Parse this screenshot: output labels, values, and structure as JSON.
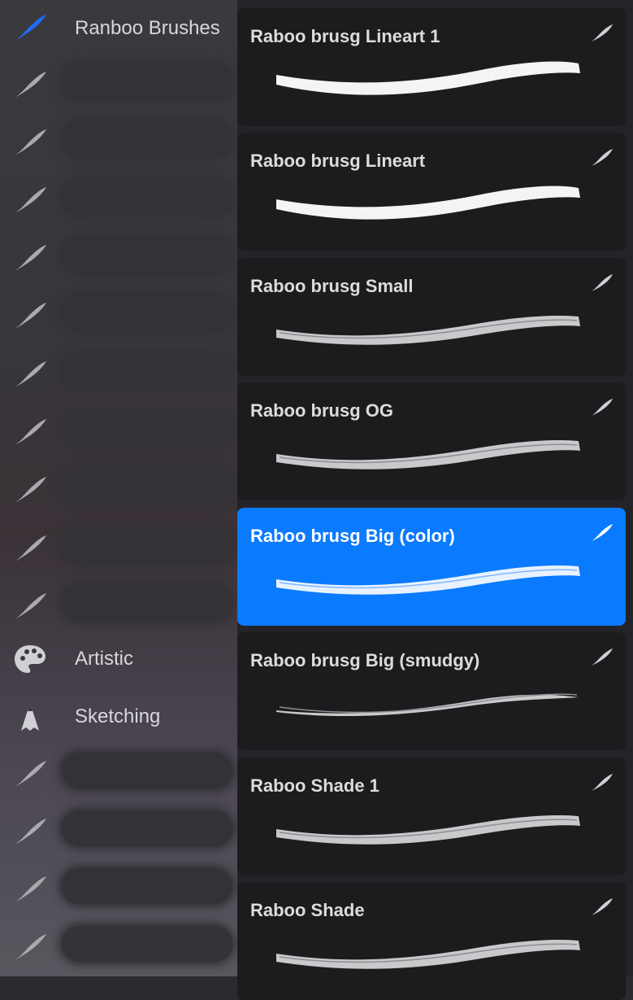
{
  "sidebar": {
    "accent_color": "#1e6ef5",
    "items": [
      {
        "label": "Ranboo Brushes",
        "icon": "brush-stroke-icon",
        "selected": true,
        "redacted": false
      },
      {
        "label": "",
        "icon": "brush-stroke-icon",
        "redacted": true
      },
      {
        "label": "",
        "icon": "brush-stroke-icon",
        "redacted": true
      },
      {
        "label": "",
        "icon": "brush-stroke-icon",
        "redacted": true
      },
      {
        "label": "",
        "icon": "brush-stroke-icon",
        "redacted": true
      },
      {
        "label": "",
        "icon": "brush-stroke-icon",
        "redacted": true
      },
      {
        "label": "",
        "icon": "brush-stroke-icon",
        "redacted": true
      },
      {
        "label": "",
        "icon": "brush-stroke-icon",
        "redacted": true
      },
      {
        "label": "",
        "icon": "brush-stroke-icon",
        "redacted": true
      },
      {
        "label": "",
        "icon": "brush-stroke-icon",
        "redacted": true
      },
      {
        "label": "",
        "icon": "brush-stroke-icon",
        "redacted": true
      },
      {
        "label": "Artistic",
        "icon": "palette-icon",
        "redacted": false
      },
      {
        "label": "Sketching",
        "icon": "pencil-nib-icon",
        "redacted": false
      },
      {
        "label": "",
        "icon": "brush-stroke-icon",
        "redacted": true
      },
      {
        "label": "",
        "icon": "brush-stroke-icon",
        "redacted": true
      },
      {
        "label": "",
        "icon": "brush-stroke-icon",
        "redacted": true
      },
      {
        "label": "",
        "icon": "brush-stroke-icon",
        "redacted": true
      }
    ]
  },
  "brushes": {
    "selected_color": "#0a7aff",
    "items": [
      {
        "name": "Raboo brusg Lineart 1",
        "stroke": "solid",
        "selected": false
      },
      {
        "name": "Raboo brusg Lineart",
        "stroke": "solid",
        "selected": false
      },
      {
        "name": "Raboo brusg Small",
        "stroke": "textured",
        "selected": false
      },
      {
        "name": "Raboo brusg OG",
        "stroke": "textured",
        "selected": false
      },
      {
        "name": "Raboo brusg Big (color)",
        "stroke": "textured",
        "selected": true
      },
      {
        "name": "Raboo brusg Big (smudgy)",
        "stroke": "thin",
        "selected": false
      },
      {
        "name": "Raboo Shade 1",
        "stroke": "textured",
        "selected": false
      },
      {
        "name": "Raboo Shade",
        "stroke": "textured",
        "selected": false
      }
    ]
  }
}
